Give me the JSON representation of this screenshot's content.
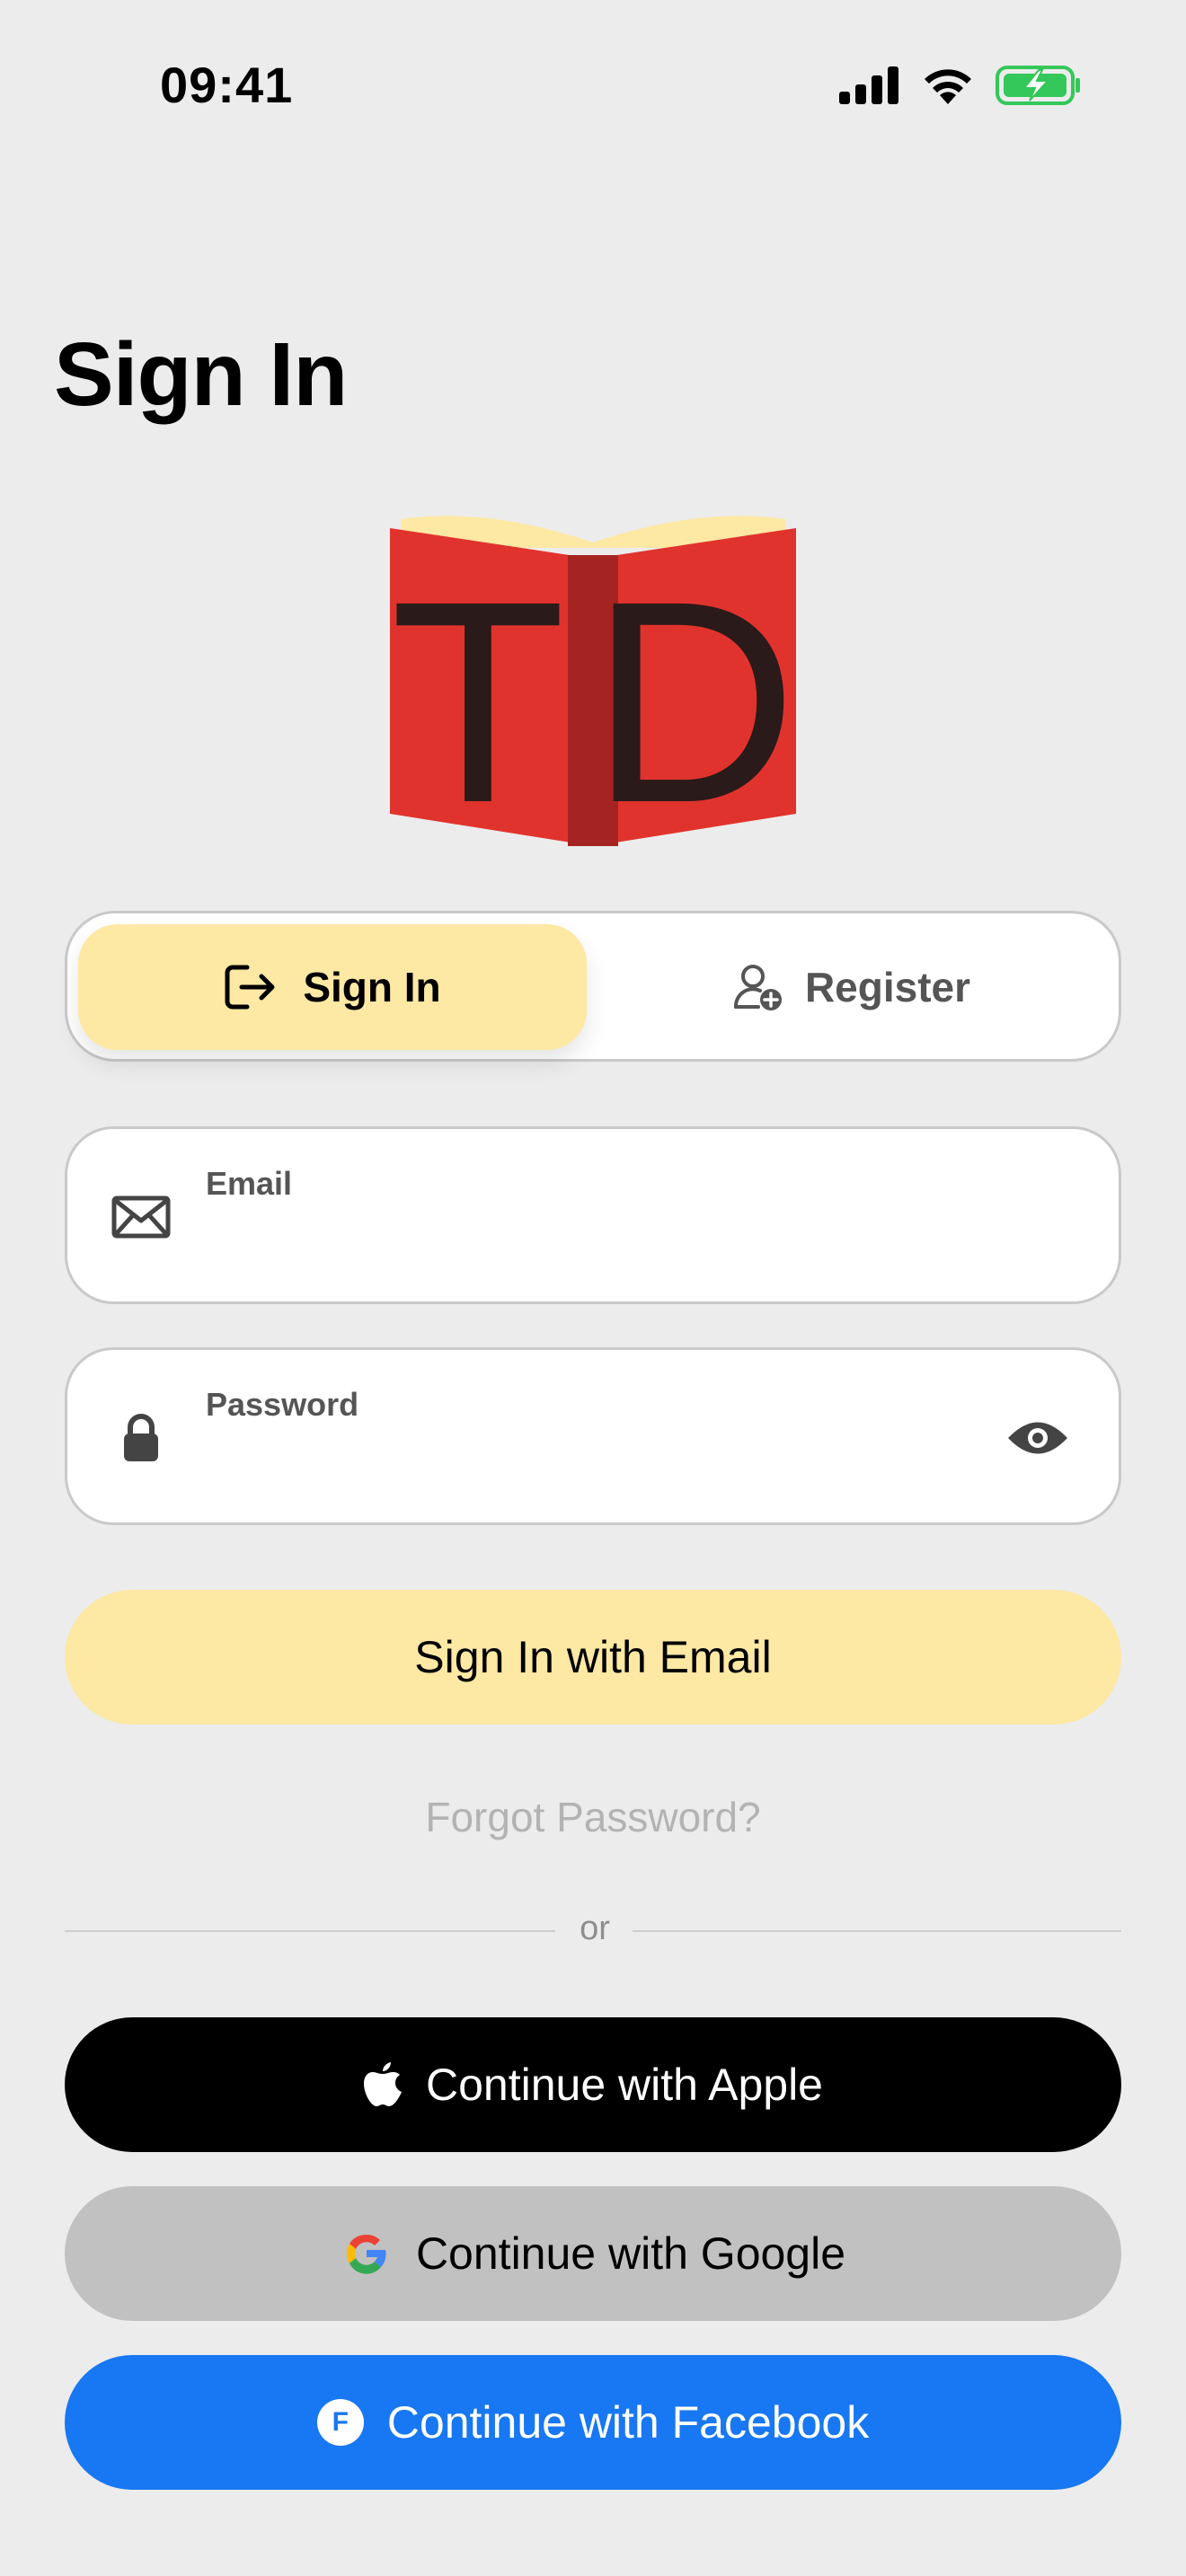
{
  "status_bar": {
    "time": "09:41"
  },
  "page": {
    "title": "Sign In"
  },
  "logo": {
    "left_letter": "T",
    "right_letter": "D"
  },
  "segment": {
    "sign_in_label": "Sign In",
    "register_label": "Register",
    "active": "sign_in"
  },
  "email_field": {
    "label": "Email",
    "value": "",
    "placeholder": ""
  },
  "password_field": {
    "label": "Password",
    "value": "",
    "placeholder": ""
  },
  "actions": {
    "sign_in_email": "Sign In with Email",
    "forgot_password": "Forgot Password?",
    "divider": "or",
    "apple": "Continue with Apple",
    "google": "Continue with Google",
    "facebook": "Continue with Facebook",
    "facebook_badge": "F"
  },
  "colors": {
    "accent_yellow": "#fde8a4",
    "facebook_blue": "#1877f2",
    "apple_black": "#000000",
    "google_gray": "#c1c1c1",
    "battery_green": "#34c759",
    "book_red": "#e1332d"
  },
  "icons": {
    "signal": "signal-icon",
    "wifi": "wifi-icon",
    "battery": "battery-charging-icon",
    "sign_in": "sign-in-icon",
    "register": "add-user-icon",
    "email": "envelope-icon",
    "password": "lock-icon",
    "show_password": "eye-icon",
    "apple": "apple-icon",
    "google": "google-icon",
    "facebook": "facebook-icon"
  }
}
